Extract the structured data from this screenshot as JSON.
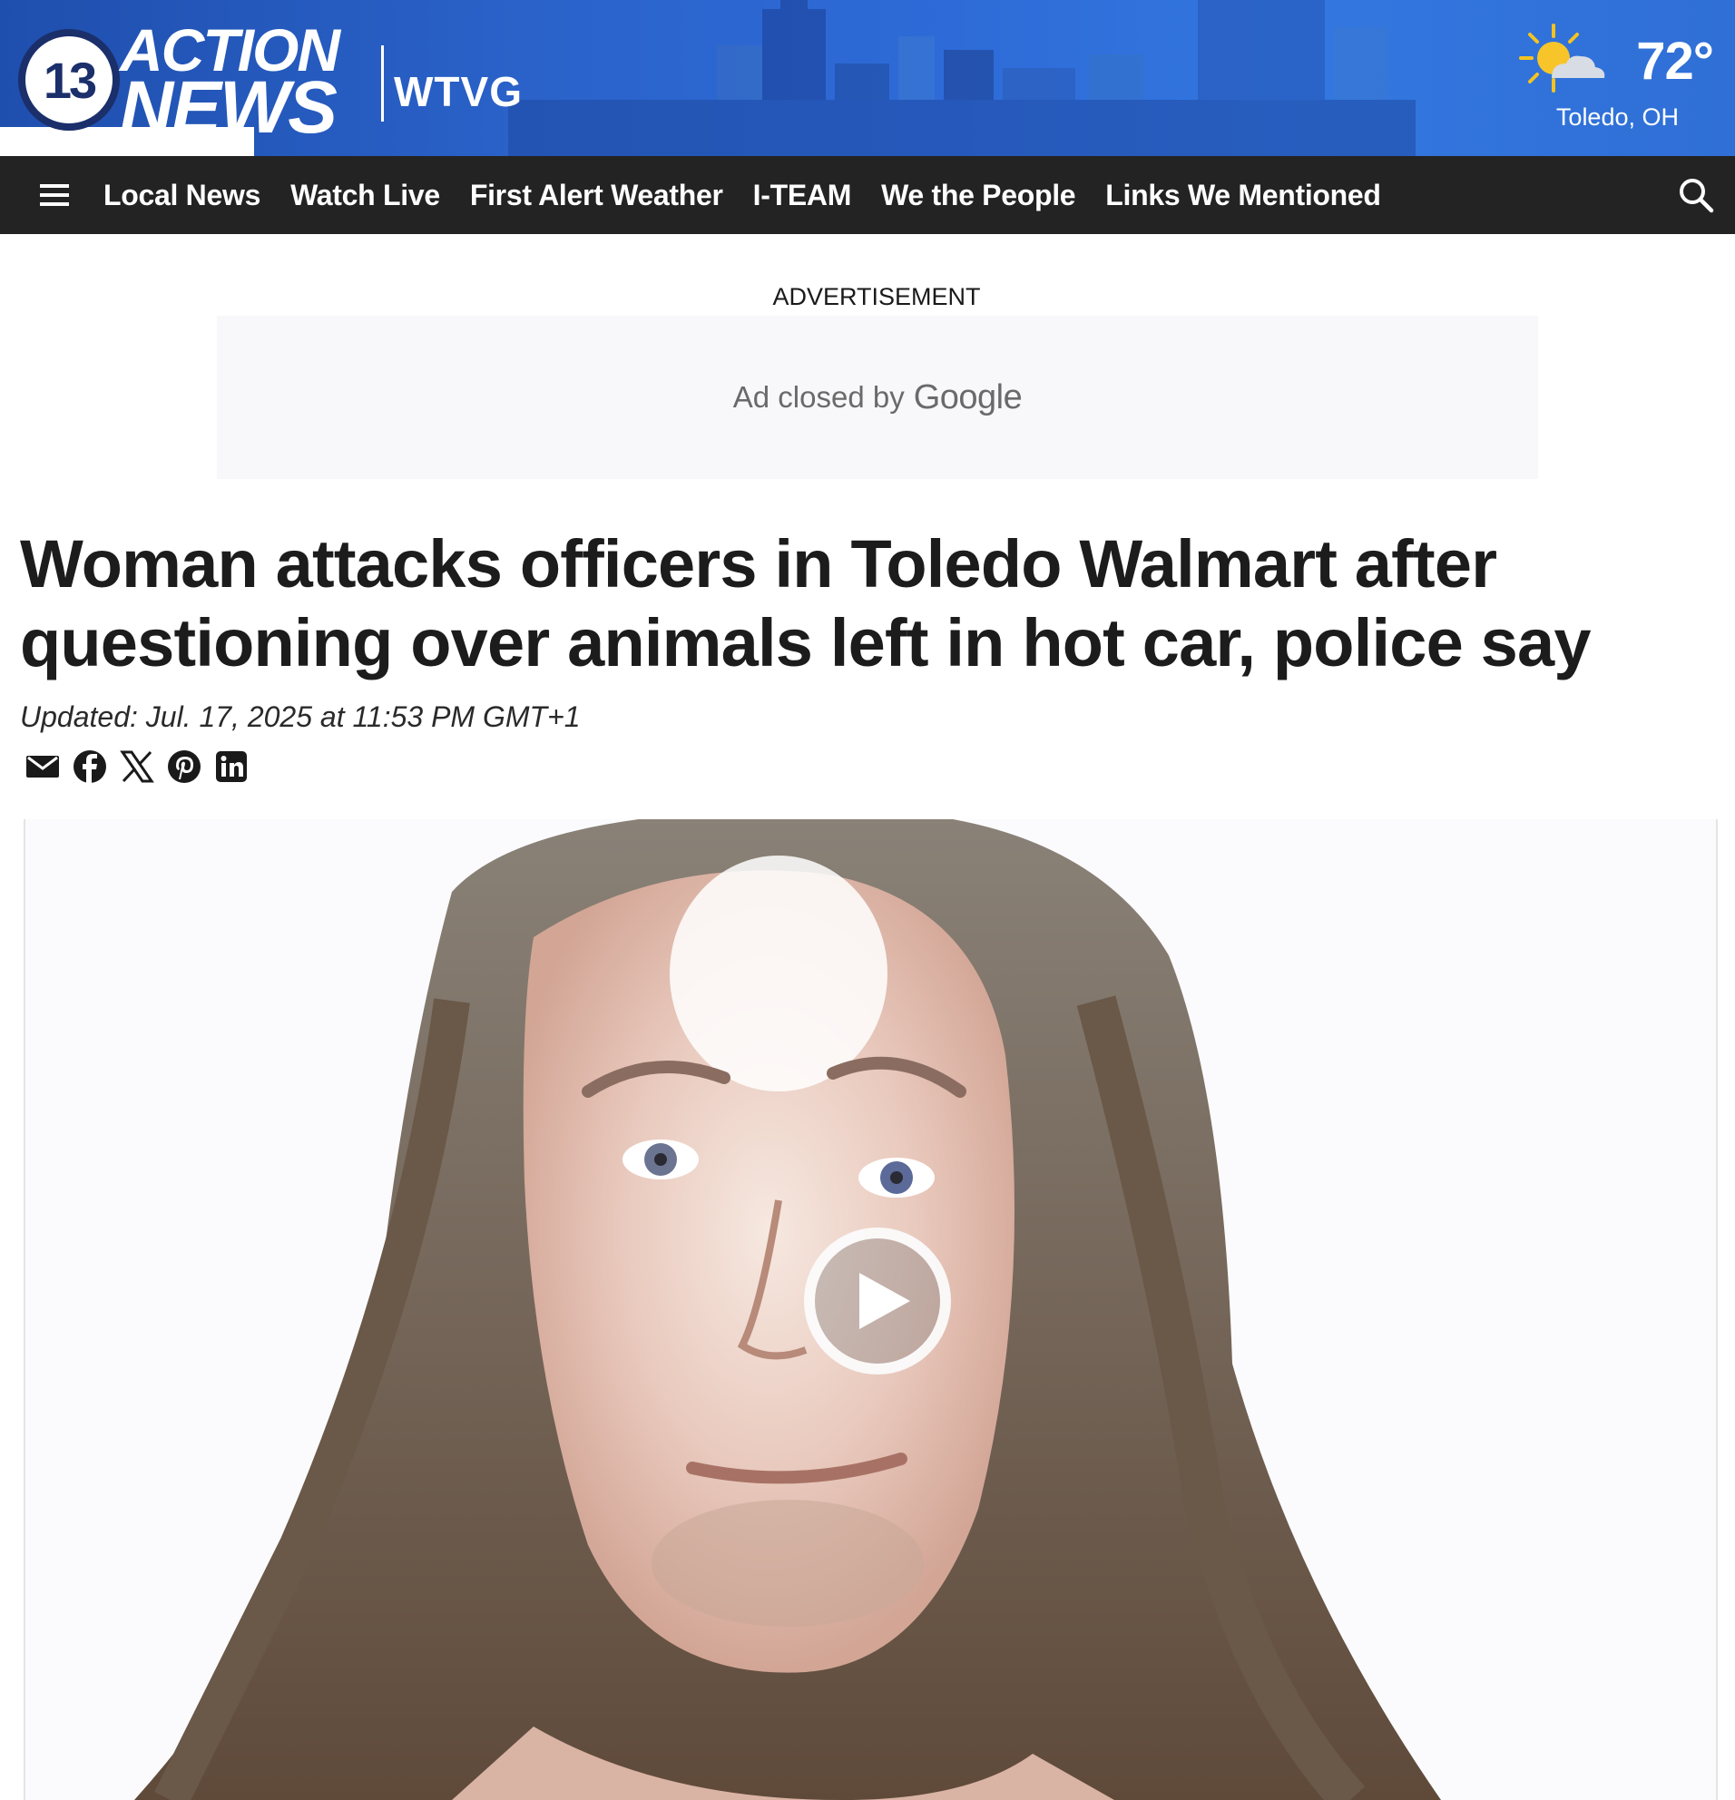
{
  "brand": {
    "channel_number": "13",
    "logo_line1": "ACTION",
    "logo_line2": "NEWS",
    "call_sign": "WTVG",
    "colors": {
      "banner": "#2a62c9",
      "logo_navy": "#1b2f6b",
      "nav_bg": "#232323"
    }
  },
  "weather": {
    "temperature": "72°",
    "location": "Toledo, OH",
    "icon": "partly-sunny-icon"
  },
  "nav": {
    "menu_icon": "hamburger-menu-icon",
    "items": [
      {
        "label": "Local News"
      },
      {
        "label": "Watch Live"
      },
      {
        "label": "First Alert Weather"
      },
      {
        "label": "I-TEAM"
      },
      {
        "label": "We the People"
      },
      {
        "label": "Links We Mentioned"
      }
    ],
    "search_icon": "search-icon"
  },
  "ad": {
    "label": "ADVERTISEMENT",
    "closed_text": "Ad closed by",
    "provider": "Google"
  },
  "article": {
    "headline": "Woman attacks officers in Toledo Walmart after questioning over animals left in hot car, police say",
    "updated": "Updated: Jul. 17, 2025 at 11:53 PM GMT+1",
    "share_icons": [
      "email-icon",
      "facebook-icon",
      "x-icon",
      "pinterest-icon",
      "linkedin-icon"
    ],
    "media": {
      "type": "video",
      "play_icon": "play-icon"
    }
  }
}
